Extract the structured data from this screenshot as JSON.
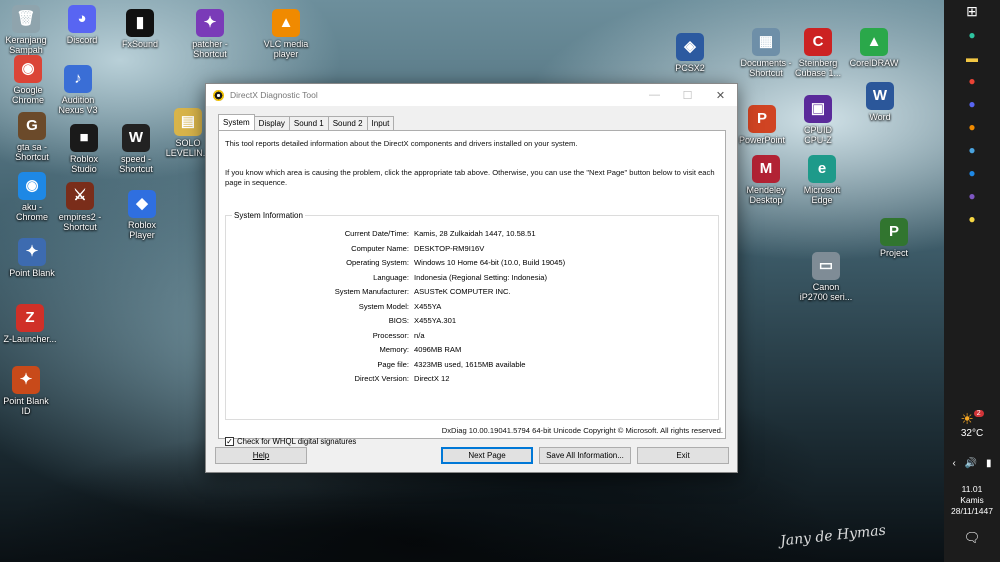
{
  "desktop": {
    "icons": [
      {
        "label": "Keranjang\nSampah",
        "glyph": "🗑",
        "color": "#8fa4ad"
      },
      {
        "label": "Discord",
        "glyph": "◕",
        "color": "#5865f2"
      },
      {
        "label": "FxSound",
        "glyph": "▮",
        "color": "#111111"
      },
      {
        "label": "patcher -\nShortcut",
        "glyph": "✦",
        "color": "#7a3bb8"
      },
      {
        "label": "VLC media\nplayer",
        "glyph": "▲",
        "color": "#f08a00"
      },
      {
        "label": "Google\nChrome",
        "glyph": "◉",
        "color": "#db4437"
      },
      {
        "label": "Audition\nNexus V3",
        "glyph": "♪",
        "color": "#3a6ed6"
      },
      {
        "label": "gta sa -\nShortcut",
        "glyph": "G",
        "color": "#6b4a2a"
      },
      {
        "label": "Roblox\nStudio",
        "glyph": "■",
        "color": "#1a1a1a"
      },
      {
        "label": "speed -\nShortcut",
        "glyph": "W",
        "color": "#222222"
      },
      {
        "label": "SOLO\nLEVELIN...",
        "glyph": "▤",
        "color": "#d8b44a"
      },
      {
        "label": "aku -\nChrome",
        "glyph": "◉",
        "color": "#1e88e5"
      },
      {
        "label": "empires2 -\nShortcut",
        "glyph": "⚔",
        "color": "#7a2d1a"
      },
      {
        "label": "Roblox\nPlayer",
        "glyph": "◆",
        "color": "#2f6fe0"
      },
      {
        "label": "Point Blank",
        "glyph": "✦",
        "color": "#3d6bb0"
      },
      {
        "label": "Z-Launcher...",
        "glyph": "Z",
        "color": "#d03028"
      },
      {
        "label": "Point Blank\nID",
        "glyph": "✦",
        "color": "#c84a1a"
      },
      {
        "label": "PCSX2",
        "glyph": "◈",
        "color": "#2c5aa0"
      },
      {
        "label": "Documents -\nShortcut",
        "glyph": "▦",
        "color": "#6e8fa8"
      },
      {
        "label": "Steinberg\nCubase 1...",
        "glyph": "C",
        "color": "#cc2222"
      },
      {
        "label": "CorelDRAW",
        "glyph": "▲",
        "color": "#2aa84a"
      },
      {
        "label": "PowerPoint",
        "glyph": "P",
        "color": "#d04423"
      },
      {
        "label": "CPUID\nCPU-Z",
        "glyph": "▣",
        "color": "#5a2a9a"
      },
      {
        "label": "Word",
        "glyph": "W",
        "color": "#2b579a"
      },
      {
        "label": "Mendeley\nDesktop",
        "glyph": "M",
        "color": "#b22234"
      },
      {
        "label": "Microsoft\nEdge",
        "glyph": "e",
        "color": "#1e9a8a"
      },
      {
        "label": "Project",
        "glyph": "P",
        "color": "#31752f"
      },
      {
        "label": "Canon\niP2700 seri...",
        "glyph": "▭",
        "color": "#7f8c96"
      }
    ],
    "signature": "Jany de Hymas"
  },
  "taskbar": {
    "weather_temp": "32°C",
    "weather_badge": "2",
    "time": "11.01",
    "day": "Kamis",
    "date": "28/11/1447",
    "pinned": [
      {
        "name": "windows-start",
        "glyph": "⊞",
        "color": "#ffffff"
      },
      {
        "name": "edge",
        "glyph": "●",
        "color": "#2ec4a0"
      },
      {
        "name": "file-explorer",
        "glyph": "▬",
        "color": "#f2c744"
      },
      {
        "name": "chrome",
        "glyph": "●",
        "color": "#ea4335"
      },
      {
        "name": "discord",
        "glyph": "●",
        "color": "#5865f2"
      },
      {
        "name": "media-player",
        "glyph": "●",
        "color": "#f08a00"
      },
      {
        "name": "app-blue",
        "glyph": "●",
        "color": "#4aa3df"
      },
      {
        "name": "chrome-profile",
        "glyph": "●",
        "color": "#1e88e5"
      },
      {
        "name": "app-purple",
        "glyph": "●",
        "color": "#7e57c2"
      },
      {
        "name": "app-yellow",
        "glyph": "●",
        "color": "#f6d743"
      }
    ]
  },
  "dialog": {
    "title": "DirectX Diagnostic Tool",
    "tabs": [
      "System",
      "Display",
      "Sound 1",
      "Sound 2",
      "Input"
    ],
    "active_tab": "System",
    "intro1": "This tool reports detailed information about the DirectX components and drivers installed on your system.",
    "intro2": "If you know which area is causing the problem, click the appropriate tab above.  Otherwise, you can use the \"Next Page\" button below to visit each page in sequence.",
    "group_title": "System Information",
    "rows": [
      {
        "key": "Current Date/Time:",
        "value": "Kamis, 28 Zulkaidah 1447, 10.58.51"
      },
      {
        "key": "Computer Name:",
        "value": "DESKTOP-RM9I16V"
      },
      {
        "key": "Operating System:",
        "value": "Windows 10 Home 64-bit (10.0, Build 19045)"
      },
      {
        "key": "Language:",
        "value": "Indonesia (Regional Setting: Indonesia)"
      },
      {
        "key": "System Manufacturer:",
        "value": "ASUSTeK COMPUTER INC."
      },
      {
        "key": "System Model:",
        "value": "X455YA"
      },
      {
        "key": "BIOS:",
        "value": "X455YA.301"
      },
      {
        "key": "Processor:",
        "value": "n/a"
      },
      {
        "key": "Memory:",
        "value": "4096MB RAM"
      },
      {
        "key": "Page file:",
        "value": "4323MB used, 1615MB available"
      },
      {
        "key": "DirectX Version:",
        "value": "DirectX 12"
      }
    ],
    "whql_label": "Check for WHQL digital signatures",
    "whql_checked": true,
    "footer": "DxDiag 10.00.19041.5794 64-bit Unicode  Copyright © Microsoft. All rights reserved.",
    "buttons": {
      "help": "Help",
      "next": "Next Page",
      "save": "Save All Information...",
      "exit": "Exit"
    }
  }
}
